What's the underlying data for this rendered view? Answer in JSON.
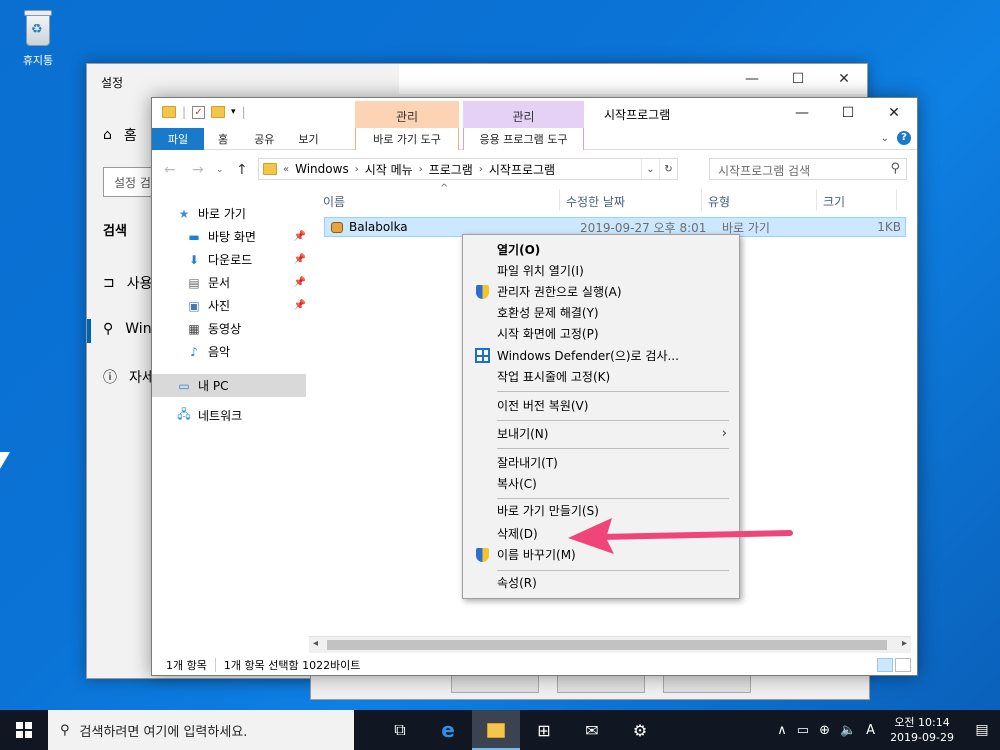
{
  "desktop": {
    "recycle_bin_label": "휴지통"
  },
  "settings": {
    "title": "설정",
    "home_label": "홈",
    "search_placeholder": "설정 검",
    "section_title": "검색",
    "items": [
      {
        "label": "사용"
      },
      {
        "label": "Win"
      },
      {
        "label": "자세"
      }
    ]
  },
  "explorer": {
    "title": "시작프로그램",
    "context_tab_a": "관리",
    "context_tab_b": "관리",
    "ribbon_tabs": [
      "파일",
      "홈",
      "공유",
      "보기"
    ],
    "ribbon_ctx_a": "바로 가기 도구",
    "ribbon_ctx_b": "응용 프로그램 도구",
    "address": {
      "prefix": "«",
      "crumbs": [
        "Windows",
        "시작 메뉴",
        "프로그램",
        "시작프로그램"
      ]
    },
    "search_placeholder": "시작프로그램 검색",
    "nav": {
      "quick_access": "바로 가기",
      "items": [
        {
          "label": "바탕 화면",
          "icon": "desktop-icon",
          "pinned": true
        },
        {
          "label": "다운로드",
          "icon": "download-icon",
          "pinned": true
        },
        {
          "label": "문서",
          "icon": "document-icon",
          "pinned": true
        },
        {
          "label": "사진",
          "icon": "picture-icon",
          "pinned": true
        },
        {
          "label": "동영상",
          "icon": "video-icon",
          "pinned": false
        },
        {
          "label": "음악",
          "icon": "music-icon",
          "pinned": false
        }
      ],
      "this_pc": "내 PC",
      "network": "네트워크"
    },
    "columns": [
      "이름",
      "수정한 날짜",
      "유형",
      "크기"
    ],
    "files": [
      {
        "name": "Balabolka",
        "modified": "2019-09-27 오후 8:01",
        "type": "바로 가기",
        "size": "1KB"
      }
    ],
    "status": {
      "count": "1개 항목",
      "selected": "1개 항목 선택함 1022바이트"
    }
  },
  "context_menu": {
    "items": [
      {
        "label": "열기(O)",
        "bold": true
      },
      {
        "label": "파일 위치 열기(I)"
      },
      {
        "label": "관리자 권한으로 실행(A)",
        "icon": "uac-shield-icon"
      },
      {
        "label": "호환성 문제 해결(Y)"
      },
      {
        "label": "시작 화면에 고정(P)"
      },
      {
        "label": "Windows Defender(으)로 검사...",
        "icon": "defender-icon"
      },
      {
        "label": "작업 표시줄에 고정(K)"
      },
      {
        "label": "이전 버전 복원(V)"
      },
      {
        "label": "보내기(N)",
        "submenu": true
      },
      {
        "label": "잘라내기(T)"
      },
      {
        "label": "복사(C)"
      },
      {
        "label": "바로 가기 만들기(S)"
      },
      {
        "label": "삭제(D)"
      },
      {
        "label": "이름 바꾸기(M)",
        "icon": "uac-shield-icon"
      },
      {
        "label": "속성(R)"
      }
    ]
  },
  "taskbar": {
    "search_placeholder": "검색하려면 여기에 입력하세요.",
    "ime": "A",
    "time": "오전 10:14",
    "date": "2019-09-29"
  },
  "colors": {
    "accent": "#1979ca",
    "arrow": "#f0457a",
    "selection": "#cce8ff"
  }
}
